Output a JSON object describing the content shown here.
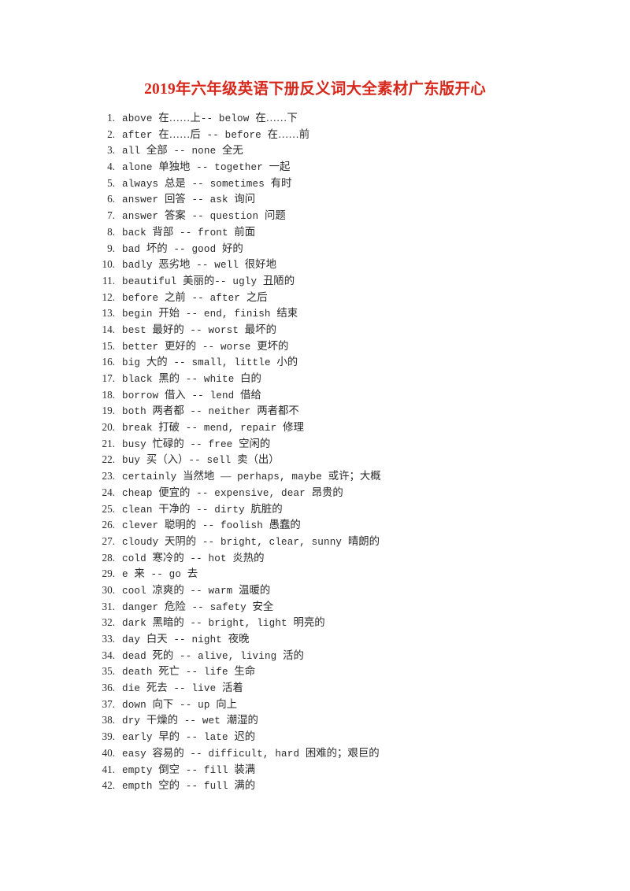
{
  "document": {
    "title": "2019年六年级英语下册反义词大全素材广东版开心",
    "title_color": "#d7281c",
    "text_color": "#2a2a2a",
    "background_color": "#ffffff"
  },
  "list": {
    "items": [
      {
        "num": "1.",
        "text": "above 在……上-- below 在……下"
      },
      {
        "num": "2.",
        "text": "after 在……后 -- before 在……前"
      },
      {
        "num": "3.",
        "text": "all 全部 -- none 全无"
      },
      {
        "num": "4.",
        "text": "alone 单独地 -- together 一起"
      },
      {
        "num": "5.",
        "text": "always 总是 -- sometimes 有时"
      },
      {
        "num": "6.",
        "text": "answer 回答 -- ask 询问"
      },
      {
        "num": "7.",
        "text": "answer 答案 -- question 问题"
      },
      {
        "num": "8.",
        "text": "back 背部 -- front 前面"
      },
      {
        "num": "9.",
        "text": "bad 坏的 -- good 好的"
      },
      {
        "num": "10.",
        "text": "badly 恶劣地 -- well 很好地"
      },
      {
        "num": "11.",
        "text": "beautiful 美丽的-- ugly 丑陋的"
      },
      {
        "num": "12.",
        "text": "before 之前 -- after 之后"
      },
      {
        "num": "13.",
        "text": "begin 开始 -- end, finish 结束"
      },
      {
        "num": "14.",
        "text": "best 最好的 -- worst 最坏的"
      },
      {
        "num": "15.",
        "text": "better 更好的 -- worse 更坏的"
      },
      {
        "num": "16.",
        "text": "big 大的 -- small, little 小的"
      },
      {
        "num": "17.",
        "text": "black 黑的 -- white 白的"
      },
      {
        "num": "18.",
        "text": "borrow 借入 -- lend 借给"
      },
      {
        "num": "19.",
        "text": "both 两者都 -- neither 两者都不"
      },
      {
        "num": "20.",
        "text": "break 打破 -- mend, repair 修理"
      },
      {
        "num": "21.",
        "text": "busy 忙碌的 -- free 空闲的"
      },
      {
        "num": "22.",
        "text": "buy 买（入）-- sell 卖（出）"
      },
      {
        "num": "23.",
        "text": "certainly 当然地 — perhaps, maybe 或许；大概"
      },
      {
        "num": "24.",
        "text": "cheap 便宜的 -- expensive, dear 昂贵的"
      },
      {
        "num": "25.",
        "text": "clean 干净的 -- dirty 肮脏的"
      },
      {
        "num": "26.",
        "text": "clever 聪明的 -- foolish 愚蠢的"
      },
      {
        "num": "27.",
        "text": "cloudy 天阴的 -- bright, clear, sunny 晴朗的"
      },
      {
        "num": "28.",
        "text": "cold 寒冷的 -- hot 炎热的"
      },
      {
        "num": "29.",
        "text": "e 来 -- go 去"
      },
      {
        "num": "30.",
        "text": "cool 凉爽的 -- warm 温暖的"
      },
      {
        "num": "31.",
        "text": "danger 危险 -- safety 安全"
      },
      {
        "num": "32.",
        "text": "dark 黑暗的 -- bright, light 明亮的"
      },
      {
        "num": "33.",
        "text": "day 白天 -- night 夜晚"
      },
      {
        "num": "34.",
        "text": "dead 死的 -- alive, living 活的"
      },
      {
        "num": "35.",
        "text": "death 死亡 -- life 生命"
      },
      {
        "num": "36.",
        "text": "die 死去 -- live 活着"
      },
      {
        "num": "37.",
        "text": "down 向下 -- up 向上"
      },
      {
        "num": "38.",
        "text": "dry 干燥的 -- wet 潮湿的"
      },
      {
        "num": "39.",
        "text": "early 早的 -- late 迟的"
      },
      {
        "num": "40.",
        "text": "easy 容易的 -- difficult, hard 困难的；艰巨的"
      },
      {
        "num": "41.",
        "text": "empty 倒空 -- fill 装满"
      },
      {
        "num": "42.",
        "text": "empth 空的 -- full 满的"
      }
    ]
  }
}
